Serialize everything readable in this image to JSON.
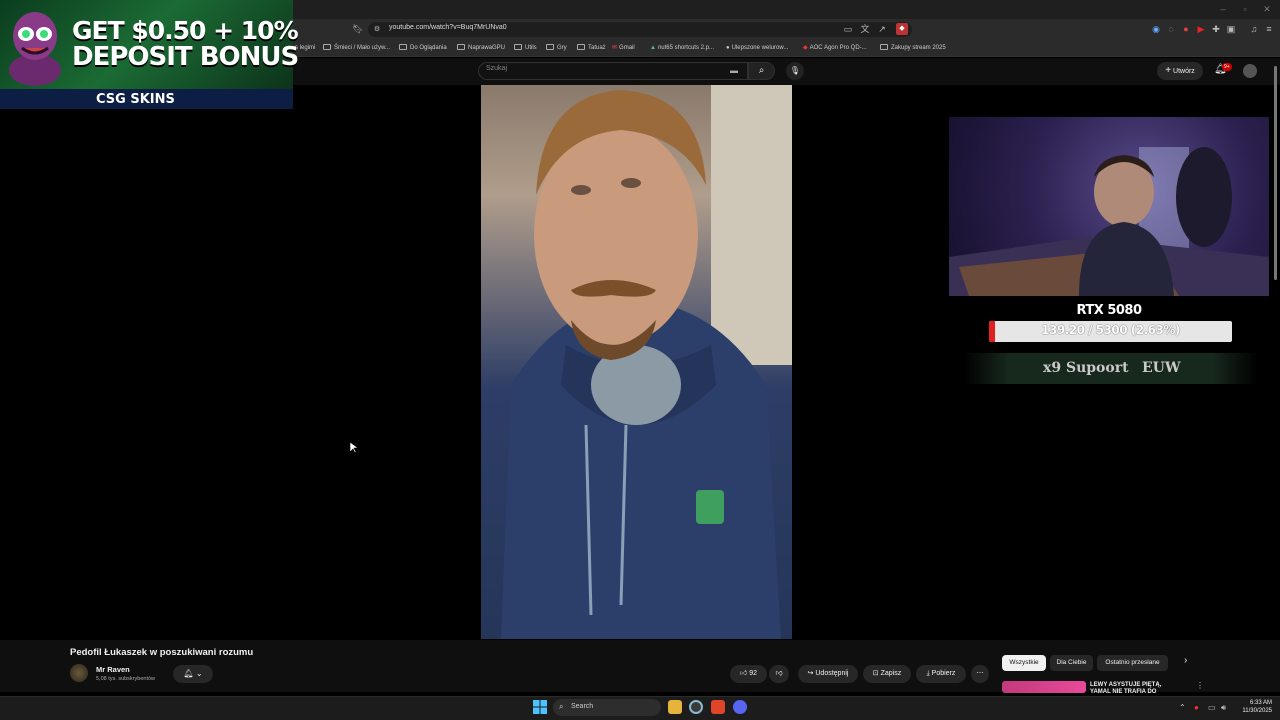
{
  "browser": {
    "url": "youtube.com/watch?v=Buq7MrUNva0",
    "bookmarks": [
      {
        "label": "s legimi"
      },
      {
        "label": "Śmieci / Mało używ..."
      },
      {
        "label": "Do Oglądania"
      },
      {
        "label": "NaprawaGPU"
      },
      {
        "label": "Utils"
      },
      {
        "label": "Gry"
      },
      {
        "label": "Tatuaż"
      },
      {
        "label": "Gmail"
      },
      {
        "label": "nut65 shortcuts 2.p..."
      },
      {
        "label": "Ulepszone welurow..."
      },
      {
        "label": "AOC Agon Pro QD-..."
      },
      {
        "label": "Zakupy stream 2025"
      }
    ]
  },
  "youtube": {
    "search_placeholder": "Szukaj",
    "create_label": "Utwórz",
    "notifications_badge": "9+"
  },
  "promo": {
    "line1": "GET $0.50 + 10%",
    "line2": "DEPOSIT BONUS",
    "brand": "CSG SKINS"
  },
  "stream_overlay": {
    "goal_title": "RTX 5080",
    "goal_progress_text": "139.20 / 5300 (2.63%)",
    "goal_progress_fraction": 0.0263,
    "role": "x9 Supoort",
    "region": "EUW"
  },
  "video": {
    "title": "Pedofil Łukaszek w poszukiwani rozumu",
    "channel_name": "Mr Raven",
    "channel_subs": "5,08 tys. subskrybentów",
    "like_count": "92",
    "share_label": "Udostępnij",
    "save_label": "Zapisz",
    "download_label": "Pobierz"
  },
  "recommendations": {
    "chips": [
      "Wszystkie",
      "Dla Ciebie",
      "Ostatnio przesłane"
    ],
    "first_title": "LEWY ASYSTUJE PIĘTĄ, YAMAL NIE TRAFIA DO"
  },
  "taskbar": {
    "search_label": "Search",
    "time": "6:33 AM",
    "date": "11/30/2025"
  },
  "colors": {
    "youtube_bg": "#0f0f0f",
    "goal_fill": "#e02020",
    "brand_red": "#cc0000"
  }
}
